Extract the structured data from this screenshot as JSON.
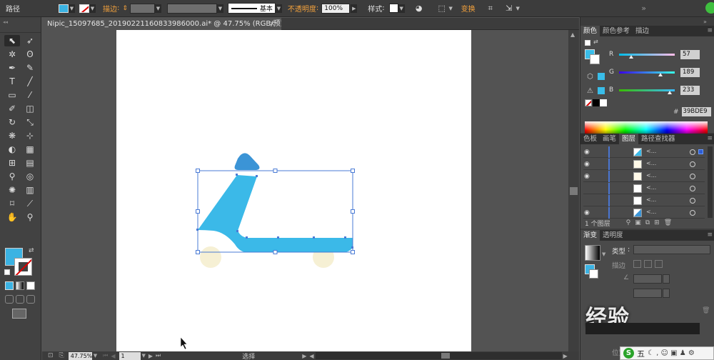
{
  "topbar": {
    "object_type": "路径",
    "stroke_label": "描边",
    "stroke_profile": "基本",
    "opacity_label": "不透明度",
    "opacity_value": "100%",
    "style_label": "样式",
    "transform_label": "变换",
    "fill_color": "#3bb3e3"
  },
  "document": {
    "tab_title": "Nipic_15097685_20190221160833986000.ai* @ 47.75% (RGB/预览)",
    "tab_close": "×"
  },
  "statusbar": {
    "zoom": "47.75%",
    "artboard_number": "1",
    "current_tool": "选择"
  },
  "color_panel": {
    "tabs": [
      "颜色",
      "颜色参考",
      "描边"
    ],
    "channels": [
      {
        "label": "R",
        "value": "57",
        "fraction": 0.224
      },
      {
        "label": "G",
        "value": "189",
        "fraction": 0.741
      },
      {
        "label": "B",
        "value": "233",
        "fraction": 0.914
      }
    ],
    "hex_symbol": "#",
    "hex": "39BDE9",
    "swatch_color": "#39bde9"
  },
  "layers_panel": {
    "tabs": [
      "色板",
      "画笔",
      "图层",
      "路径查找器"
    ],
    "active_tab": "图层",
    "rows": [
      {
        "visible": true,
        "name": "<...",
        "selected": true
      },
      {
        "visible": true,
        "name": "<...",
        "selected": false
      },
      {
        "visible": true,
        "name": "<...",
        "selected": false
      },
      {
        "visible": false,
        "name": "<...",
        "selected": false
      },
      {
        "visible": false,
        "name": "<...",
        "selected": false
      },
      {
        "visible": true,
        "name": "<...",
        "selected": false
      }
    ],
    "footer": "1 个图层"
  },
  "gradient_panel": {
    "tabs": [
      "渐变",
      "透明度"
    ],
    "type_label": "类型",
    "stroke_label": "描边",
    "location_label": "位置"
  },
  "watermark": {
    "text": "经验"
  },
  "ime": {
    "logo": "S",
    "mode": "五",
    "icons": "☾ , ☺ ▣ ♟ ⚙"
  },
  "colors": {
    "scooter_blue": "#3bb9e8",
    "wheel_cream": "#f6f0d4"
  }
}
